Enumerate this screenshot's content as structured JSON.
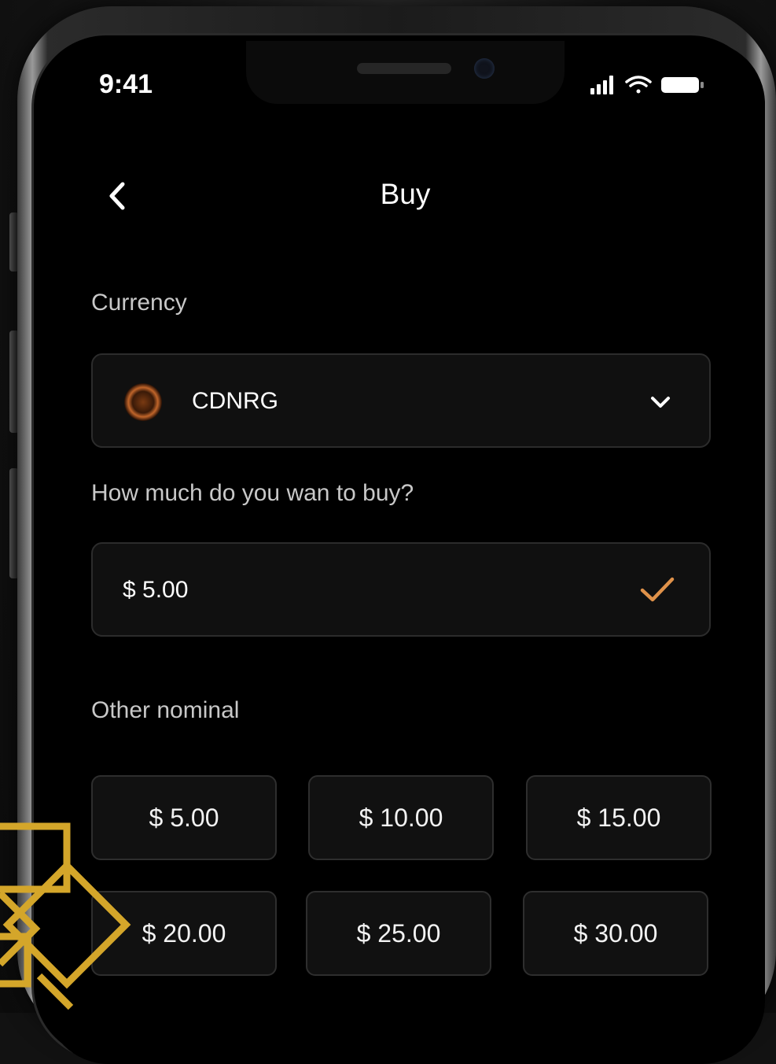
{
  "status_bar": {
    "time": "9:41"
  },
  "header": {
    "title": "Buy"
  },
  "currency": {
    "label": "Currency",
    "selected": "CDNRG"
  },
  "amount": {
    "label": "How much do you wan to buy?",
    "value": "$ 5.00"
  },
  "nominal": {
    "label": "Other nominal",
    "options": [
      "$ 5.00",
      "$ 10.00",
      "$ 15.00",
      "$ 20.00",
      "$ 25.00",
      "$ 30.00"
    ]
  },
  "colors": {
    "accent": "#e0924a",
    "background": "#000000",
    "field_bg": "#101010",
    "gold_decoration": "#d4a62a"
  }
}
